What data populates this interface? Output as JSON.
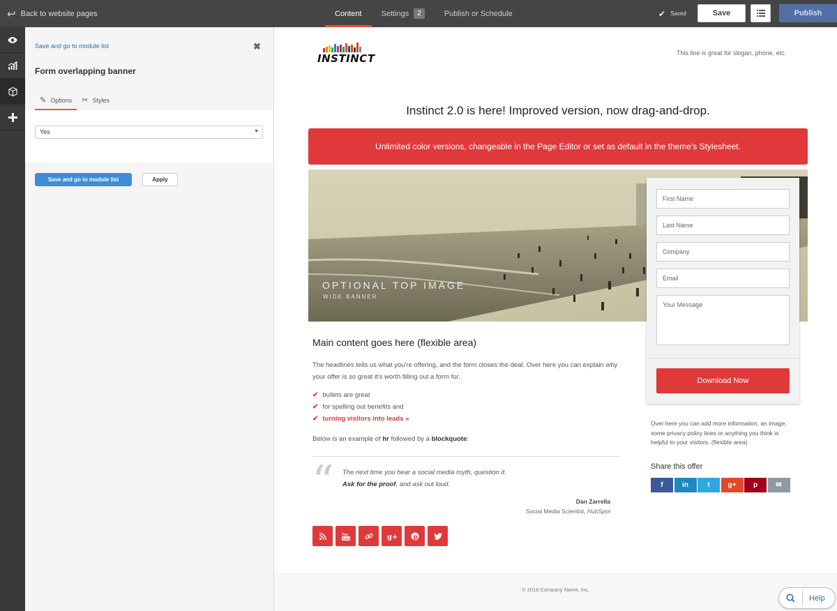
{
  "topbar": {
    "back_label": "Back to website pages",
    "tabs": [
      {
        "label": "Content"
      },
      {
        "label": "Settings",
        "badge": "2"
      },
      {
        "label": "Publish or Schedule"
      }
    ],
    "saved_label": "Saved",
    "save_label": "Save",
    "publish_label": "Publish"
  },
  "rail": {
    "items": [
      {
        "icon": "eye-icon"
      },
      {
        "icon": "analytics-icon"
      },
      {
        "icon": "module-box-icon"
      },
      {
        "icon": "plus-icon"
      }
    ]
  },
  "panel": {
    "top_link": "Save and go to module list",
    "title": "Form overlapping banner",
    "tabs": [
      {
        "label": "Options"
      },
      {
        "label": "Styles"
      }
    ],
    "select_value": "Yes",
    "primary_button": "Save and go to module list",
    "apply_button": "Apply"
  },
  "preview": {
    "logo_text": "INSTINCT",
    "slogan": "This line is great for slogan, phone, etc.",
    "headline": "Instinct 2.0 is here! Improved version, now drag-and-drop.",
    "redbar": "Unlimited color versions, changeable in the Page Editor or set as default in the theme's Stylesheet.",
    "banner_title": "OPTIONAL TOP IMAGE",
    "banner_subtitle": "WIDE BANNER",
    "form": {
      "first_name": "First Name",
      "last_name": "Last Name",
      "company": "Company",
      "email": "Email",
      "message": "Your Message",
      "button": "Download Now"
    },
    "main_heading": "Main content goes here (flexible area)",
    "paragraph": "The headlines tells us what you're offering, and the form closes the deal. Over here you can explain why your offer is so great it's worth filling out a form for.",
    "bullets": [
      "bullets are great",
      "for spelling out benefits and",
      "turning visitors into leads »"
    ],
    "below_pre": "Below is an example of ",
    "below_hr": "hr",
    "below_mid": " followed by a ",
    "below_bq": "blockquote",
    "below_post": ":",
    "quote_line1": "The next time you hear a social media myth, question it.",
    "quote_line2_bold": "Ask for the proof",
    "quote_line2_rest": ", and ask out loud.",
    "quote_author": "Dan Zarrella",
    "quote_role_pre": "Social Media Scientist, ",
    "quote_role_company": "HubSpot",
    "social_icons": [
      "rss-icon",
      "youtube-icon",
      "link-icon",
      "google-plus-icon",
      "pinterest-icon",
      "twitter-icon"
    ],
    "side_info": "Over here you can add more information, an image, some privacy policy lines or anything you think is helpful to your visitors. (flexible area)",
    "share_heading": "Share this offer",
    "share_buttons": [
      {
        "icon": "facebook-icon",
        "glyph": "f",
        "color": "#3b5998"
      },
      {
        "icon": "linkedin-icon",
        "glyph": "in",
        "color": "#1f88be"
      },
      {
        "icon": "twitter-icon",
        "glyph": "t",
        "color": "#2ba9e1"
      },
      {
        "icon": "google-plus-icon",
        "glyph": "g+",
        "color": "#e34829"
      },
      {
        "icon": "pinterest-icon",
        "glyph": "p",
        "color": "#a0001a"
      },
      {
        "icon": "email-icon",
        "glyph": "✉",
        "color": "#8e9aa2"
      }
    ],
    "footer": "© 2016 Company Name, Inc."
  },
  "help_label": "Help",
  "colors": {
    "accent": "#e0393b",
    "tab_underline": "#e8542f",
    "primary_blue": "#3f8dd6",
    "publish_blue": "#516fa4"
  }
}
